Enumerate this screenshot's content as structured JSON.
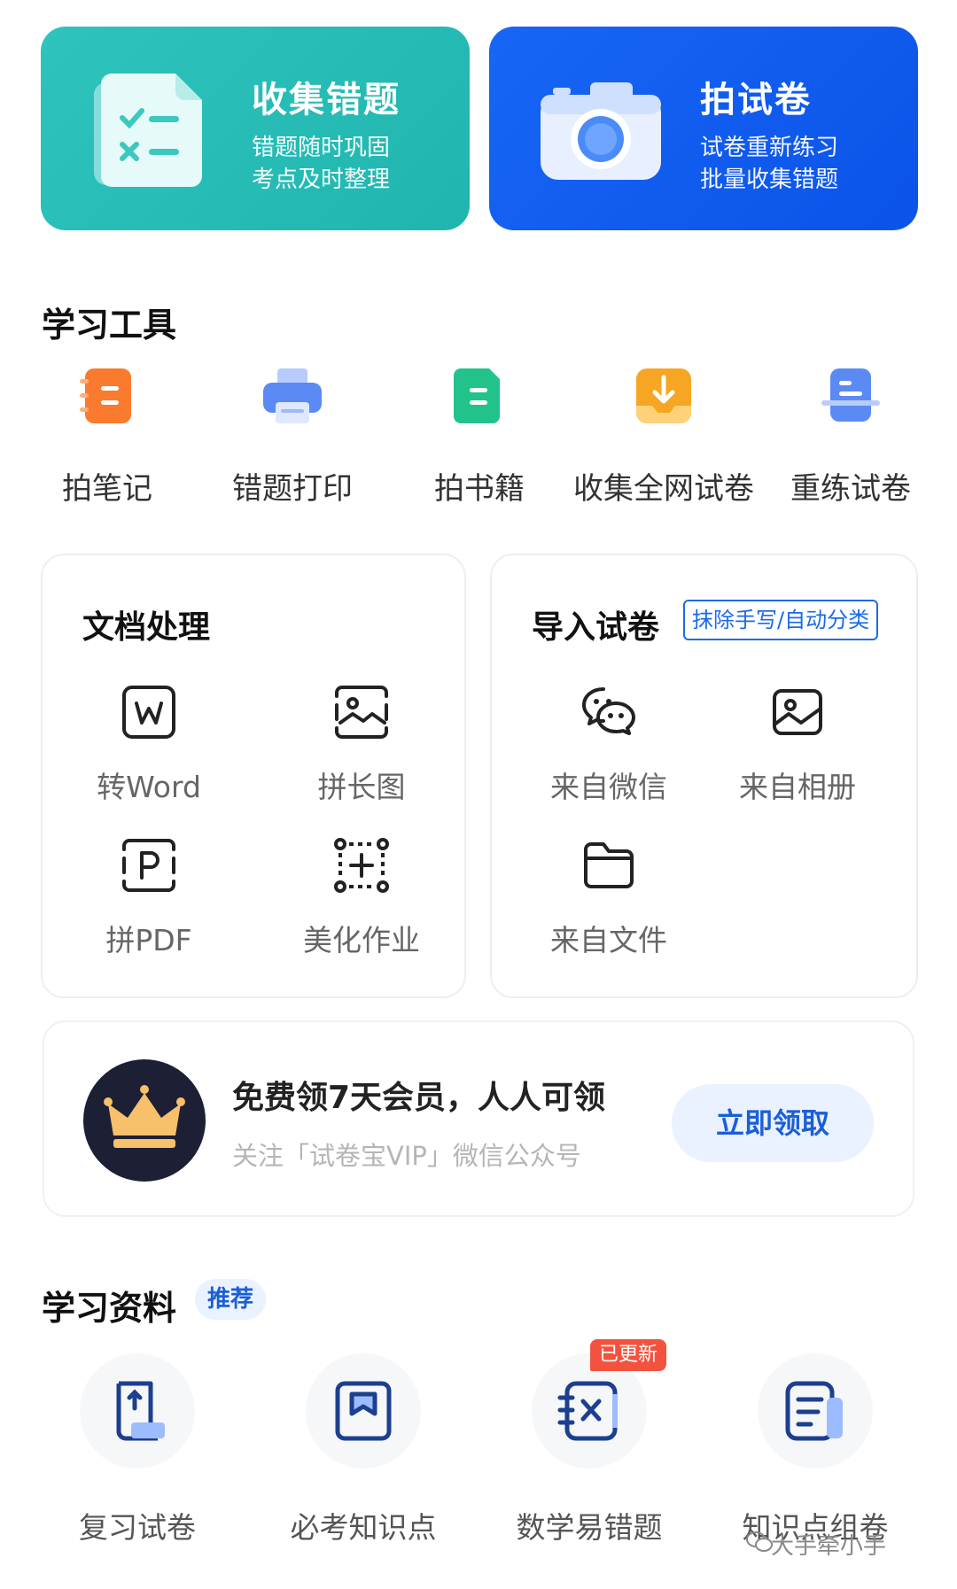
{
  "hero": {
    "collect_wrong": {
      "title": "收集错题",
      "line1": "错题随时巩固",
      "line2": "考点及时整理",
      "color": "#2ec4bd"
    },
    "photo_paper": {
      "title": "拍试卷",
      "line1": "试卷重新练习",
      "line2": "批量收集错题",
      "color": "#1766f6"
    }
  },
  "study_tools": {
    "title": "学习工具",
    "items": [
      {
        "label": "拍笔记",
        "icon": "notebook-icon",
        "color": "#fa7a2e"
      },
      {
        "label": "错题打印",
        "icon": "printer-icon",
        "color": "#5b8af5"
      },
      {
        "label": "拍书籍",
        "icon": "book-icon",
        "color": "#22c38a"
      },
      {
        "label": "收集全网试卷",
        "icon": "download-tray-icon",
        "color": "#f6a623"
      },
      {
        "label": "重练试卷",
        "icon": "retrain-paper-icon",
        "color": "#5b8af5"
      }
    ]
  },
  "doc_card": {
    "title": "文档处理",
    "items": [
      {
        "label": "转Word",
        "icon": "word-icon"
      },
      {
        "label": "拼长图",
        "icon": "long-image-icon"
      },
      {
        "label": "拼PDF",
        "icon": "pdf-icon"
      },
      {
        "label": "美化作业",
        "icon": "beautify-icon"
      }
    ]
  },
  "import_card": {
    "title": "导入试卷",
    "badge": "抹除手写/自动分类",
    "items": [
      {
        "label": "来自微信",
        "icon": "wechat-icon"
      },
      {
        "label": "来自相册",
        "icon": "album-icon"
      },
      {
        "label": "来自文件",
        "icon": "folder-icon"
      }
    ]
  },
  "vip": {
    "title": "免费领7天会员，人人可领",
    "subtitle": "关注「试卷宝VIP」微信公众号",
    "button": "立即领取",
    "icon": "crown-icon"
  },
  "materials": {
    "title": "学习资料",
    "badge": "推荐",
    "new_tag": "已更新",
    "items": [
      {
        "label": "复习试卷",
        "icon": "review-paper-icon"
      },
      {
        "label": "必考知识点",
        "icon": "bookmark-book-icon"
      },
      {
        "label": "数学易错题",
        "icon": "math-error-icon"
      },
      {
        "label": "知识点组卷",
        "icon": "compose-paper-icon"
      }
    ]
  },
  "watermark": "大手牵小手"
}
